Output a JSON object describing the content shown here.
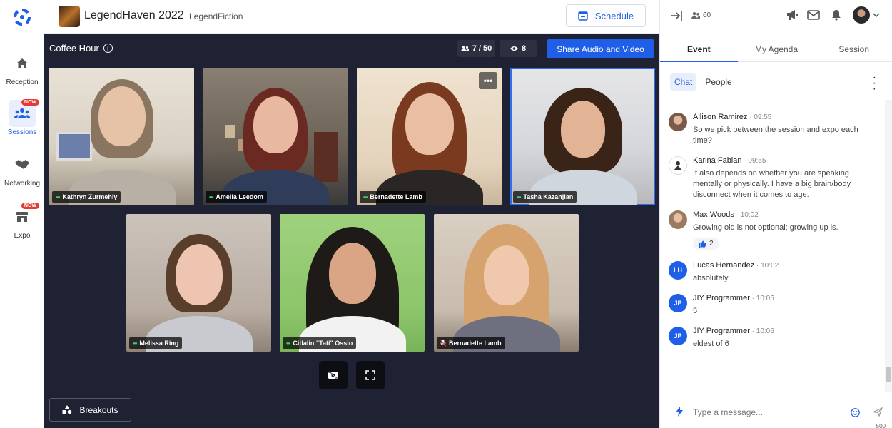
{
  "header": {
    "event_title": "LegendHaven 2022",
    "organizer": "LegendFiction",
    "schedule_label": "Schedule"
  },
  "rail": {
    "items": [
      {
        "label": "Reception",
        "icon": "home-icon",
        "badge": ""
      },
      {
        "label": "Sessions",
        "icon": "people-icon",
        "badge": "NOW"
      },
      {
        "label": "Networking",
        "icon": "handshake-icon",
        "badge": ""
      },
      {
        "label": "Expo",
        "icon": "booth-icon",
        "badge": "NOW"
      }
    ]
  },
  "stage": {
    "title": "Coffee Hour",
    "participants": "7 / 50",
    "viewers": "8",
    "share_label": "Share Audio and Video",
    "breakouts_label": "Breakouts",
    "tiles": [
      {
        "name": "Kathryn Zurmehly"
      },
      {
        "name": "Amelia Leedom"
      },
      {
        "name": "Bernadette Lamb"
      },
      {
        "name": "Tasha Kazanjian"
      },
      {
        "name": "Melissa Ring"
      },
      {
        "name": "Citlalin \"Tati\" Ossio"
      },
      {
        "name": "Bernadette Lamb"
      }
    ]
  },
  "panel": {
    "attendee_count": "60",
    "tabs": [
      "Event",
      "My Agenda",
      "Session"
    ],
    "subtabs": [
      "Chat",
      "People"
    ],
    "messages": [
      {
        "author": "Allison Ramirez",
        "time": "09:55",
        "text": "So we pick between the session and expo each time?",
        "initials": ""
      },
      {
        "author": "Karina Fabian",
        "time": "09:55",
        "text": "It also depends on whether you are speaking mentally or physically. I have a big brain/body disconnect when it comes to age.",
        "initials": ""
      },
      {
        "author": "Max Woods",
        "time": "10:02",
        "text": "Growing old is not optional; growing up is.",
        "initials": "",
        "reaction_count": "2"
      },
      {
        "author": "Lucas Hernandez",
        "time": "10:02",
        "text": "absolutely",
        "initials": "LH"
      },
      {
        "author": "JIY Programmer",
        "time": "10:05",
        "text": "5",
        "initials": "JP"
      },
      {
        "author": "JIY Programmer",
        "time": "10:06",
        "text": "eldest of 6",
        "initials": "JP"
      }
    ],
    "composer_placeholder": "Type a message...",
    "char_count": "500"
  },
  "colors": {
    "accent": "#1f5fe8",
    "stage_bg": "#1f2232",
    "badge_red": "#e53935",
    "speaking_outline": "#2e6df0"
  }
}
